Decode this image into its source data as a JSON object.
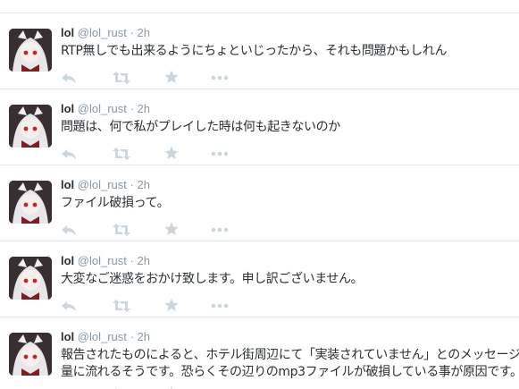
{
  "timeline": {
    "tweets": [
      {
        "name": "lol",
        "handle": "@lol_rust",
        "separator": "·",
        "time": "2h",
        "text": "RTP無しでも出来るようにちょといじったから、それも問題かもしれん"
      },
      {
        "name": "lol",
        "handle": "@lol_rust",
        "separator": "·",
        "time": "2h",
        "text": "問題は、何で私がプレイした時は何も起きないのか"
      },
      {
        "name": "lol",
        "handle": "@lol_rust",
        "separator": "·",
        "time": "2h",
        "text": "ファイル破損って。"
      },
      {
        "name": "lol",
        "handle": "@lol_rust",
        "separator": "·",
        "time": "2h",
        "text": "大変なご迷惑をおかけ致します。申し訳ございません。"
      },
      {
        "name": "lol",
        "handle": "@lol_rust",
        "separator": "·",
        "time": "2h",
        "text_lines": [
          "報告されたものによると、ホテル街周辺にて「実装されていません」とのメッセージが大",
          "量に流れるそうです。恐らくその辺りのmp3ファイルが破損している事が原因です。"
        ]
      }
    ],
    "icons": {
      "reply": "reply-icon",
      "retweet": "retweet-icon",
      "favorite": "star-icon",
      "more": "more-icon"
    },
    "colors": {
      "icon": "#ccd6dd",
      "name": "#292f33",
      "meta": "#8899a6",
      "divider": "#e1e8ed"
    }
  }
}
